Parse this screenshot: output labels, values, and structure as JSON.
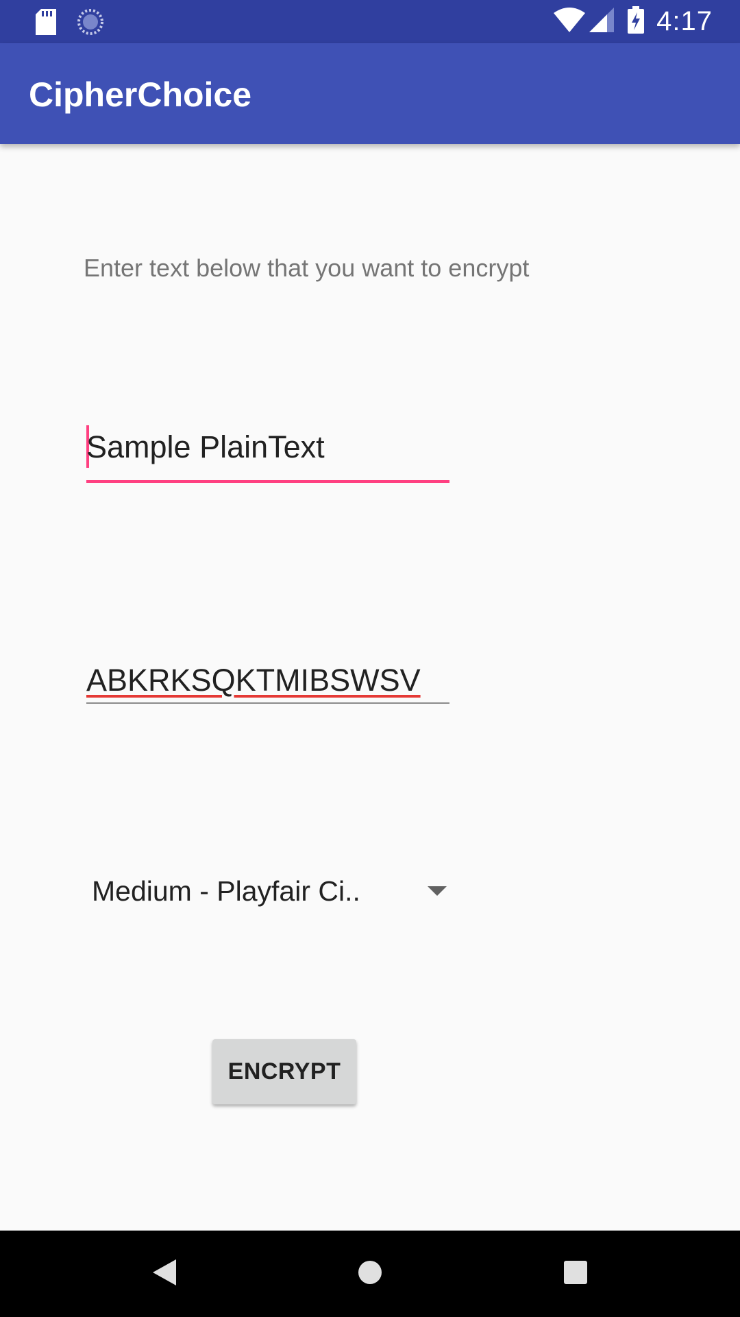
{
  "status_bar": {
    "time": "4:17",
    "icons": [
      "sd-card-icon",
      "sync-icon",
      "wifi-icon",
      "signal-icon",
      "battery-charging-icon"
    ]
  },
  "app_bar": {
    "title": "CipherChoice",
    "color": "#3f51b5"
  },
  "main": {
    "instruction": "Enter text below that you want to encrypt",
    "plaintext_input": "Sample PlainText",
    "ciphertext_output": "ABKRKSQKTMIBSWSV",
    "cipher_select": "Medium - Playfair Ci..",
    "encrypt_button": "ENCRYPT",
    "accent_color": "#ff4081"
  },
  "nav_bar": {
    "icons": [
      "back-icon",
      "home-icon",
      "recents-icon"
    ]
  }
}
